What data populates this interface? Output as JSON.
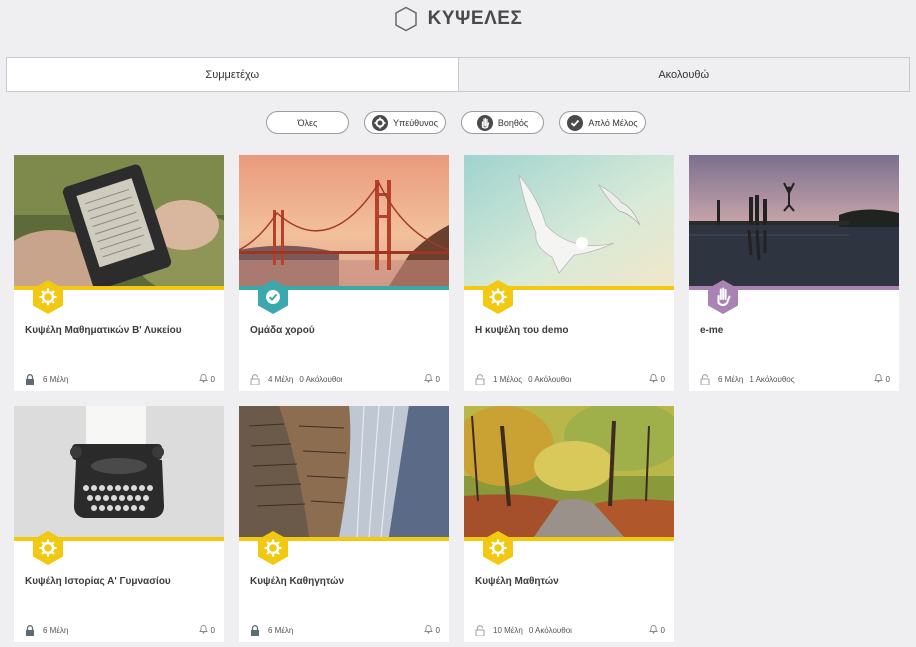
{
  "page": {
    "title": "ΚΥΨΕΛΕΣ"
  },
  "tabs": [
    {
      "label": "Συμμετέχω",
      "active": true
    },
    {
      "label": "Ακολουθώ",
      "active": false
    }
  ],
  "filters": [
    {
      "label": "Όλες",
      "icon": ""
    },
    {
      "label": "Υπεύθυνος",
      "icon": "gear-icon"
    },
    {
      "label": "Βοηθός",
      "icon": "hand-icon"
    },
    {
      "label": "Απλό Μέλος",
      "icon": "check-icon"
    }
  ],
  "colors": {
    "accent": "#f2c811",
    "teal": "#3aa8ad",
    "purple": "#a883b3"
  },
  "cards": [
    {
      "name": "Κυψέλη Μαθηματικών Β' Λυκείου",
      "members": "6 Μέλη",
      "followers": "",
      "notifications": "0",
      "role_icon": "gear-icon",
      "image": "e-reader in hands",
      "locked": true
    },
    {
      "name": "Ομάδα χορού",
      "members": "4 Μέλη",
      "followers": "0 Ακόλουθοι",
      "notifications": "0",
      "role_icon": "check-icon",
      "image": "golden gate bridge",
      "locked": false
    },
    {
      "name": "Η κυψέλη του demo",
      "members": "1 Μέλος",
      "followers": "0 Ακόλουθοι",
      "notifications": "0",
      "role_icon": "gear-icon",
      "image": "seagulls in sky",
      "locked": false
    },
    {
      "name": "e-me",
      "members": "6 Μέλη",
      "followers": "1 Ακόλουθος",
      "notifications": "0",
      "role_icon": "hand-icon",
      "image": "people jumping at sunset",
      "locked": false
    },
    {
      "name": "Κυψέλη Ιστορίας Α' Γυμνασίου",
      "members": "6 Μέλη",
      "followers": "",
      "notifications": "0",
      "role_icon": "gear-icon",
      "image": "typewriter",
      "locked": true
    },
    {
      "name": "Κυψέλη Καθηγητών",
      "members": "6 Μέλη",
      "followers": "",
      "notifications": "0",
      "role_icon": "gear-icon",
      "image": "library bookshelves",
      "locked": true
    },
    {
      "name": "Κυψέλη Μαθητών",
      "members": "10 Μέλη",
      "followers": "0 Ακόλουθοι",
      "notifications": "0",
      "role_icon": "gear-icon",
      "image": "autumn forest path",
      "locked": false
    }
  ]
}
